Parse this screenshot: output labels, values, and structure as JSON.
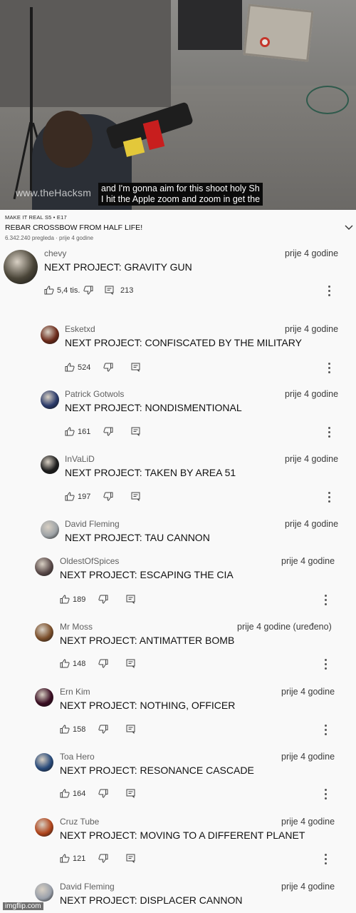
{
  "video": {
    "watermark": "www.theHacksm",
    "caption_line1": "and I'm gonna aim for this shoot holy Sh",
    "caption_line2": "I hit the Apple zoom and zoom in get the"
  },
  "info": {
    "show_label": "MAKE IT REAL  S5 • E17",
    "title": "REBAR CROSSBOW FROM HALF LIFE!",
    "meta": "6.342.240 pregleda · prije 4 godine"
  },
  "colors": {
    "background": "#f9f9f9",
    "text": "#111111",
    "secondary": "#606060"
  },
  "comments": [
    {
      "author": "chevy",
      "time": "prije 4 godine",
      "text": "NEXT PROJECT:  GRAVITY GUN",
      "likes": "5,4 tis.",
      "replies": "213"
    },
    {
      "author": "Esketxd",
      "time": "prije 4 godine",
      "text": "NEXT PROJECT: CONFISCATED BY THE MILITARY",
      "likes": "524"
    },
    {
      "author": "Patrick Gotwols",
      "time": "prije 4 godine",
      "text": "NEXT PROJECT: NONDISMENTIONAL",
      "likes": "161"
    },
    {
      "author": "InVaLiD",
      "time": "prije 4 godine",
      "text": "NEXT PROJECT: TAKEN BY AREA 51",
      "likes": "197"
    },
    {
      "author": "David Fleming",
      "time": "prije 4 godine",
      "text": "NEXT PROJECT: TAU CANNON"
    },
    {
      "author": "OldestOfSpices",
      "time": "prije 4 godine",
      "text": "NEXT PROJECT: ESCAPING THE CIA",
      "likes": "189"
    },
    {
      "author": "Mr Moss",
      "time": "prije 4 godine (uređeno)",
      "text": "NEXT PROJECT: ANTIMATTER BOMB",
      "likes": "148"
    },
    {
      "author": "Ern Kim",
      "time": "prije 4 godine",
      "text": "NEXT PROJECT: NOTHING, OFFICER",
      "likes": "158"
    },
    {
      "author": "Toa Hero",
      "time": "prije 4 godine",
      "text": "NEXT PROJECT: RESONANCE CASCADE",
      "likes": "164"
    },
    {
      "author": "Cruz Tube",
      "time": "prije 4 godine",
      "text": "NEXT PROJECT: MOVING TO A DIFFERENT PLANET",
      "likes": "121"
    },
    {
      "author": "David Fleming",
      "time": "prije 4 godine",
      "text": "NEXT PROJECT: DISPLACER CANNON"
    }
  ],
  "watermark": "imgflip.com"
}
